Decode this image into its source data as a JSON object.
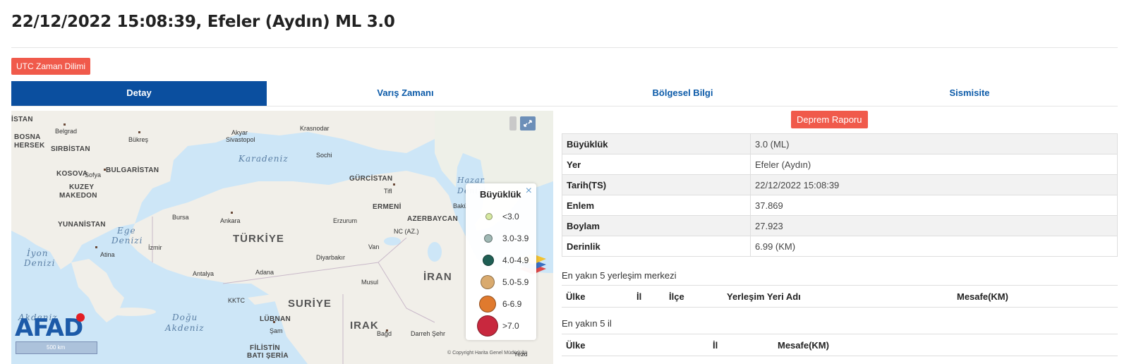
{
  "title": "22/12/2022 15:08:39, Efeler (Aydın) ML 3.0",
  "utc_button": "UTC Zaman Dilimi",
  "tabs": [
    "Detay",
    "Varış Zamanı",
    "Bölgesel Bilgi",
    "Sismisite"
  ],
  "active_tab": "Detay",
  "report_button": "Deprem Raporu",
  "details": [
    {
      "key": "Büyüklük",
      "value": "3.0 (ML)"
    },
    {
      "key": "Yer",
      "value": "Efeler (Aydın)"
    },
    {
      "key": "Tarih(TS)",
      "value": "22/12/2022 15:08:39"
    },
    {
      "key": "Enlem",
      "value": "37.869"
    },
    {
      "key": "Boylam",
      "value": "27.923"
    },
    {
      "key": "Derinlik",
      "value": "6.99 (KM)"
    }
  ],
  "nearest_settlements": {
    "label": "En yakın 5 yerleşim merkezi",
    "columns": [
      "Ülke",
      "İl",
      "İlçe",
      "Yerleşim Yeri Adı",
      "Mesafe(KM)"
    ]
  },
  "nearest_provinces": {
    "label": "En yakın 5 il",
    "columns": [
      "Ülke",
      "İl",
      "Mesafe(KM)"
    ]
  },
  "legend": {
    "title": "Büyüklük",
    "close": "×",
    "items": [
      {
        "label": "<3.0",
        "color": "#d6e8a0"
      },
      {
        "label": "3.0-3.9",
        "color": "#9fb8b4"
      },
      {
        "label": "4.0-4.9",
        "color": "#1f5e54"
      },
      {
        "label": "5.0-5.9",
        "color": "#d9aa6e"
      },
      {
        "label": "6-6.9",
        "color": "#e07a2e"
      },
      {
        "label": ">7.0",
        "color": "#c8283e"
      }
    ]
  },
  "map": {
    "logo": "AFAD",
    "scale": "500 km",
    "copyright": "© Copyright Harita Genel Müdürlüğü",
    "labels": {
      "istan": "İSTAN",
      "belgrad": "Belgrad",
      "bosna": "BOSNA",
      "hersek": "HERSEK",
      "sirbistan": "SIRBİSTAN",
      "bukres": "Bükreş",
      "kosova": "KOSOVA",
      "bulgaristan": "BULGARİSTAN",
      "sofya": "Sofya",
      "kuzey": "KUZEY",
      "makedon": "MAKEDON",
      "yunanistan": "YUNANİSTAN",
      "akyar": "Akyar",
      "sivastopol": "Sivastopol",
      "krasnodar": "Krasnodar",
      "karadeniz": "Karadeniz",
      "sochi": "Sochi",
      "gurcistan": "GÜRCİSTAN",
      "tiflis": "Tifl",
      "ermeni": "ERMENİ",
      "azerbaycan": "AZERBAYCAN",
      "bursa": "Bursa",
      "ankara": "Ankara",
      "erzurum": "Erzurum",
      "ege": "Ege",
      "ege2": "Denizi",
      "izmir": "İzmir",
      "turkiye": "TÜRKİYE",
      "iyon": "İyon",
      "iyon2": "Denizi",
      "atina": "Atina",
      "van": "Van",
      "diyarbakir": "Diyarbakır",
      "antalya": "Antalya",
      "adana": "Adana",
      "iran": "İRAN",
      "musul": "Musul",
      "kktc": "KKTC",
      "suriye": "SURİYE",
      "akdeniz": "Akdeniz",
      "dogu": "Doğu",
      "dogu2": "Akdeniz",
      "lubnan": "LÜBNAN",
      "sam": "Şam",
      "irak": "IRAK",
      "bagdat": "Bağd",
      "darreh": "Darreh Şehr",
      "filistin": "FİLİSTİN",
      "batisera": "BATI ŞERİA",
      "hazar": "Hazar",
      "baku": "Bakü",
      "denizi_top": "Denizi",
      "nc": "NC (AZ.)",
      "yezd": "Yezd"
    }
  },
  "colors": {
    "accent": "#0b4f9f",
    "tab_text": "#0b5aa8",
    "button_red": "#f05a4b",
    "sea": "#cde6f7",
    "land": "#f1efe9"
  }
}
